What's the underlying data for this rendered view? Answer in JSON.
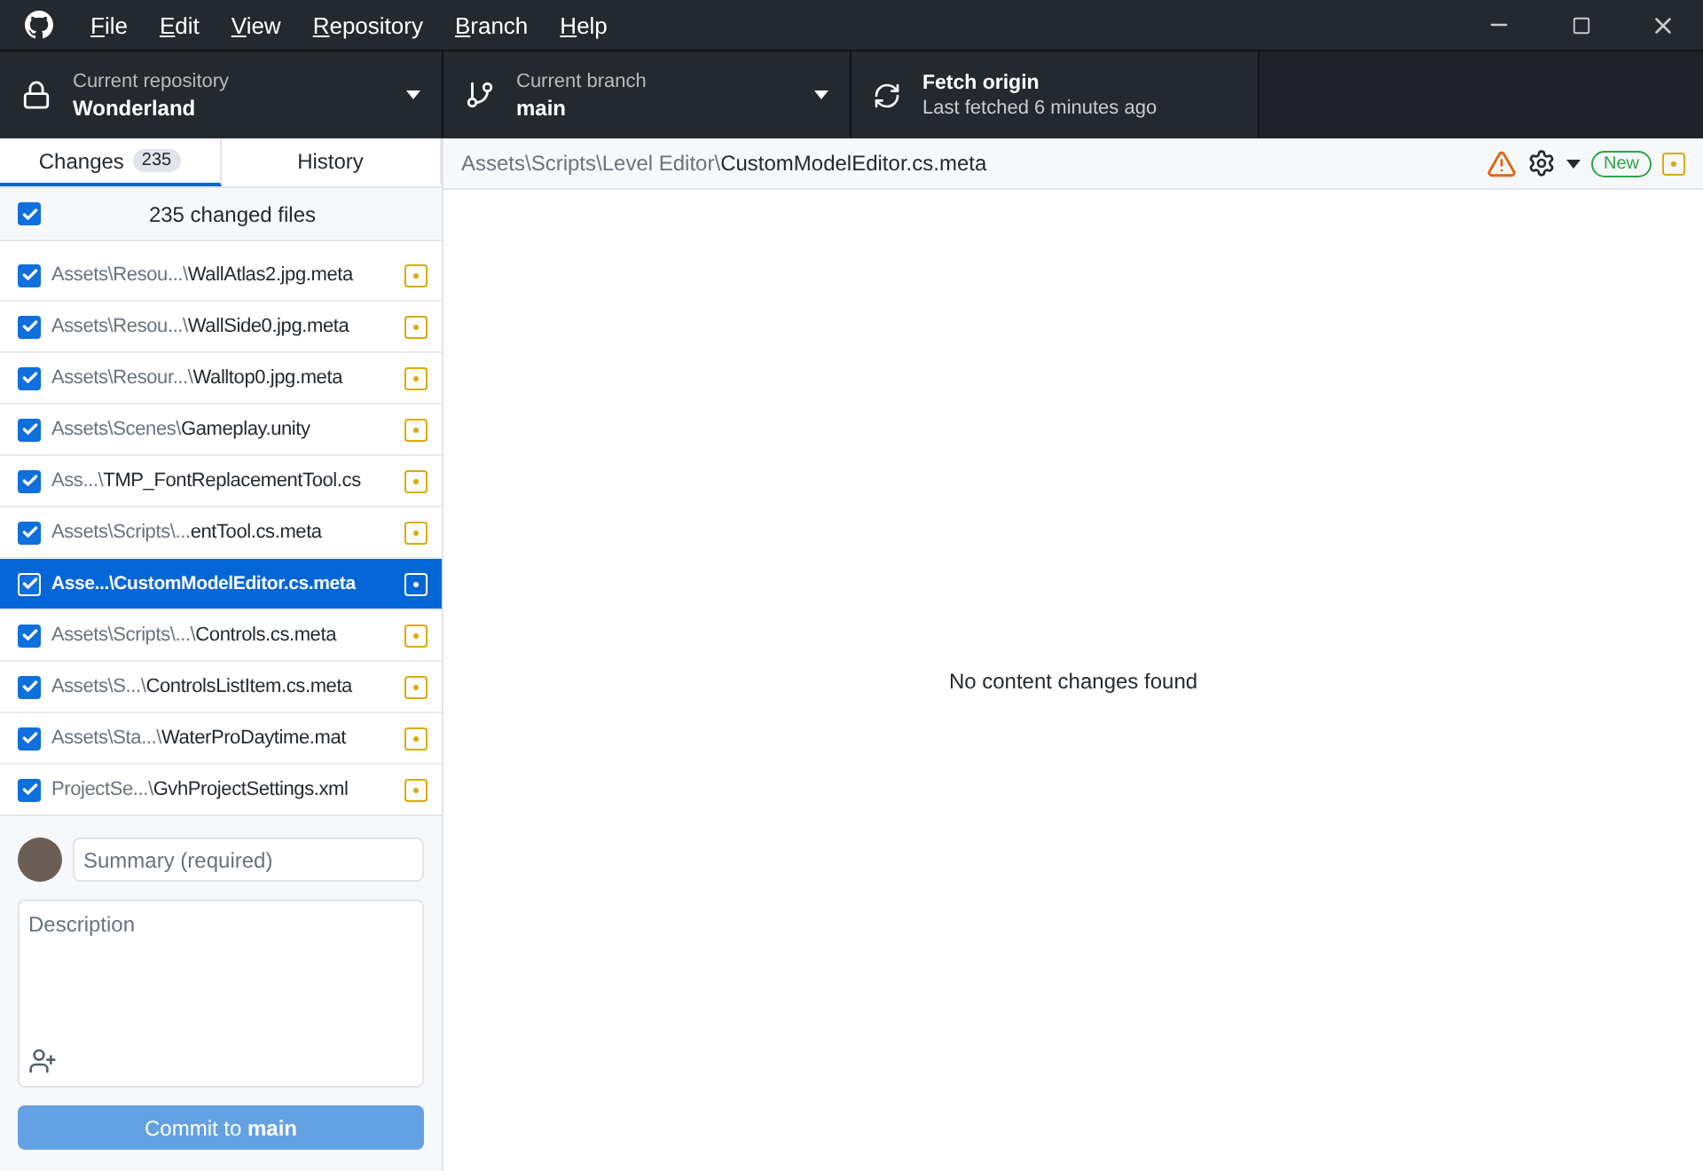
{
  "menu": [
    "File",
    "Edit",
    "View",
    "Repository",
    "Branch",
    "Help"
  ],
  "toolbar": [
    {
      "kind": "repository",
      "label": "Current repository",
      "value": "Wonderland"
    },
    {
      "kind": "branch",
      "label": "Current branch",
      "value": "main"
    },
    {
      "kind": "fetch",
      "label": "Fetch origin",
      "value": "Last fetched 6 minutes ago"
    }
  ],
  "tabs": [
    {
      "label": "Changes",
      "count": "235",
      "selected": true
    },
    {
      "label": "History",
      "selected": false
    }
  ],
  "changes_header": {
    "label": "235 changed files",
    "checked": true
  },
  "files": [
    {
      "dir": "Assets\\Resou...\\",
      "name": "WallAtlas2.jpg.meta",
      "checked": true,
      "selected": false
    },
    {
      "dir": "Assets\\Resou...\\",
      "name": "WallSide0.jpg.meta",
      "checked": true,
      "selected": false
    },
    {
      "dir": "Assets\\Resour...\\",
      "name": "Walltop0.jpg.meta",
      "checked": true,
      "selected": false
    },
    {
      "dir": "Assets\\Scenes\\",
      "name": "Gameplay.unity",
      "checked": true,
      "selected": false
    },
    {
      "dir": "Ass...\\",
      "name": "TMP_FontReplacementTool.cs",
      "checked": true,
      "selected": false
    },
    {
      "dir": "Assets\\Scripts\\...",
      "name": "entTool.cs.meta",
      "checked": true,
      "selected": false
    },
    {
      "dir": "Asse...\\",
      "name": "CustomModelEditor.cs.meta",
      "checked": true,
      "selected": true
    },
    {
      "dir": "Assets\\Scripts\\...\\",
      "name": "Controls.cs.meta",
      "checked": true,
      "selected": false
    },
    {
      "dir": "Assets\\S...\\",
      "name": "ControlsListItem.cs.meta",
      "checked": true,
      "selected": false
    },
    {
      "dir": "Assets\\Sta...\\",
      "name": "WaterProDaytime.mat",
      "checked": true,
      "selected": false
    },
    {
      "dir": "ProjectSe...\\",
      "name": "GvhProjectSettings.xml",
      "checked": true,
      "selected": false
    }
  ],
  "commit": {
    "summary_placeholder": "Summary (required)",
    "description_placeholder": "Description",
    "button": "Commit to **main**"
  },
  "diff": {
    "dir": "Assets\\Scripts\\Level Editor\\",
    "name": "CustomModelEditor.cs.meta",
    "badge": "New",
    "message": "No content changes found"
  }
}
